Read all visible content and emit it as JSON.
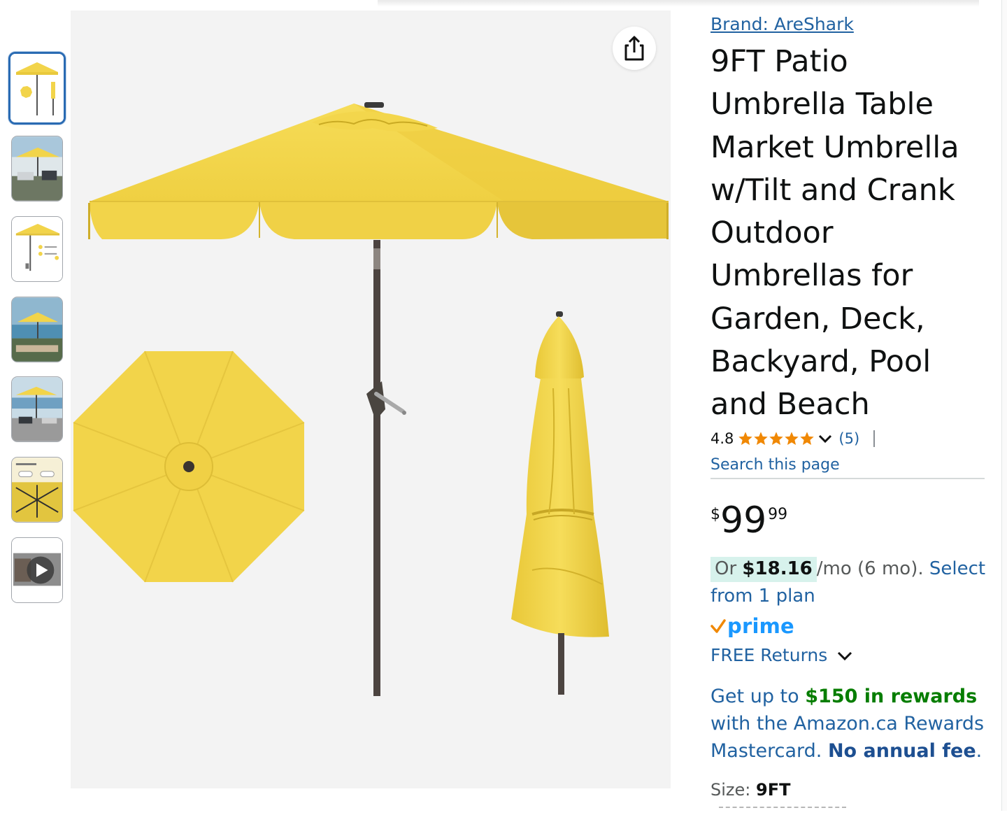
{
  "brand": {
    "label": "Brand: AreShark"
  },
  "product": {
    "title": "9FT Patio Umbrella Table Market Umbrella w/Tilt and Crank Outdoor Umbrellas for Garden, Deck, Backyard, Pool and Beach"
  },
  "rating": {
    "value": "4.8",
    "count": "(5)",
    "stars": 5
  },
  "search_link": "Search this page",
  "price": {
    "symbol": "$",
    "whole": "99",
    "fraction": "99"
  },
  "installment": {
    "prefix": "Or",
    "amount": "$18.16",
    "suffix": "/mo (6 mo).",
    "link": "Select from 1 plan"
  },
  "prime": {
    "check": "✓",
    "label": "prime"
  },
  "returns": {
    "label": "FREE Returns"
  },
  "rewards": {
    "prefix": "Get up to",
    "amount": "$150 in rewards",
    "middle": "with the Amazon.ca Rewards Mastercard.",
    "bold": "No annual fee",
    "end": "."
  },
  "size": {
    "label": "Size:",
    "value": "9FT"
  },
  "thumbnails": [
    {
      "kind": "product-diagram",
      "selected": true
    },
    {
      "kind": "lifestyle-patio"
    },
    {
      "kind": "feature-infographic"
    },
    {
      "kind": "lifestyle-poolside"
    },
    {
      "kind": "lifestyle-seaside"
    },
    {
      "kind": "tilt-infographic"
    },
    {
      "kind": "video"
    }
  ],
  "colors": {
    "canopy": "#f2d44a",
    "link": "#2162a1",
    "star": "#f08804",
    "prime": "#1a98ff",
    "rewards_green": "#067d00",
    "installment_bg": "#d7f2ec",
    "selected_thumb_border": "#2a6bb3"
  },
  "icons": [
    "share-icon",
    "star-icon",
    "chevron-down-icon",
    "prime-check-icon",
    "play-icon"
  ]
}
